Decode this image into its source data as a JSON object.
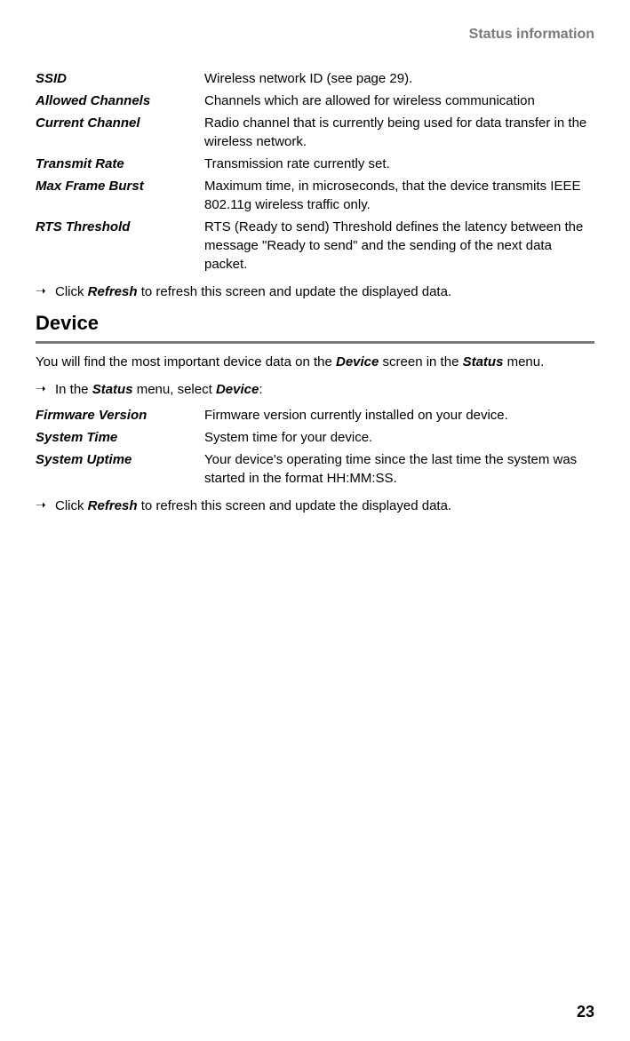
{
  "header": "Status information",
  "defs1": [
    {
      "label": "SSID",
      "value": "Wireless network ID (see page 29)."
    },
    {
      "label": "Allowed Channels",
      "value": "Channels which are allowed for wireless communication"
    },
    {
      "label": "Current Channel",
      "value": "Radio channel that is currently being used for data transfer in the wireless network."
    },
    {
      "label": "Transmit Rate",
      "value": "Transmission rate currently set."
    },
    {
      "label": "Max Frame Burst",
      "value": "Maximum time, in microseconds, that the device transmits IEEE 802.11g wireless traffic only."
    },
    {
      "label": "RTS Threshold",
      "value": "RTS (Ready to send) Threshold defines the latency between the message \"Ready to send\" and the sending of the next data packet."
    }
  ],
  "refresh1": {
    "pre": "Click ",
    "bold": "Refresh",
    "post": " to refresh this screen and update the displayed data."
  },
  "section": "Device",
  "intro": {
    "p1": "You will find the most important device data on the ",
    "b1": "Device",
    "p2": " screen in the ",
    "b2": "Status",
    "p3": " menu."
  },
  "step": {
    "pre": "In the ",
    "b1": "Status",
    "mid": " menu, select ",
    "b2": "Device",
    "post": ":"
  },
  "defs2": [
    {
      "label": "Firmware Version",
      "value": "Firmware version currently installed on your device."
    },
    {
      "label": "System Time",
      "value": "System time for your device."
    },
    {
      "label": "System Uptime",
      "value": "Your device's operating time since the last time the system was started in the format HH:MM:SS."
    }
  ],
  "refresh2": {
    "pre": "Click ",
    "bold": "Refresh",
    "post": " to refresh this screen and update the displayed data."
  },
  "pagenum": "23",
  "arrow": "➝"
}
